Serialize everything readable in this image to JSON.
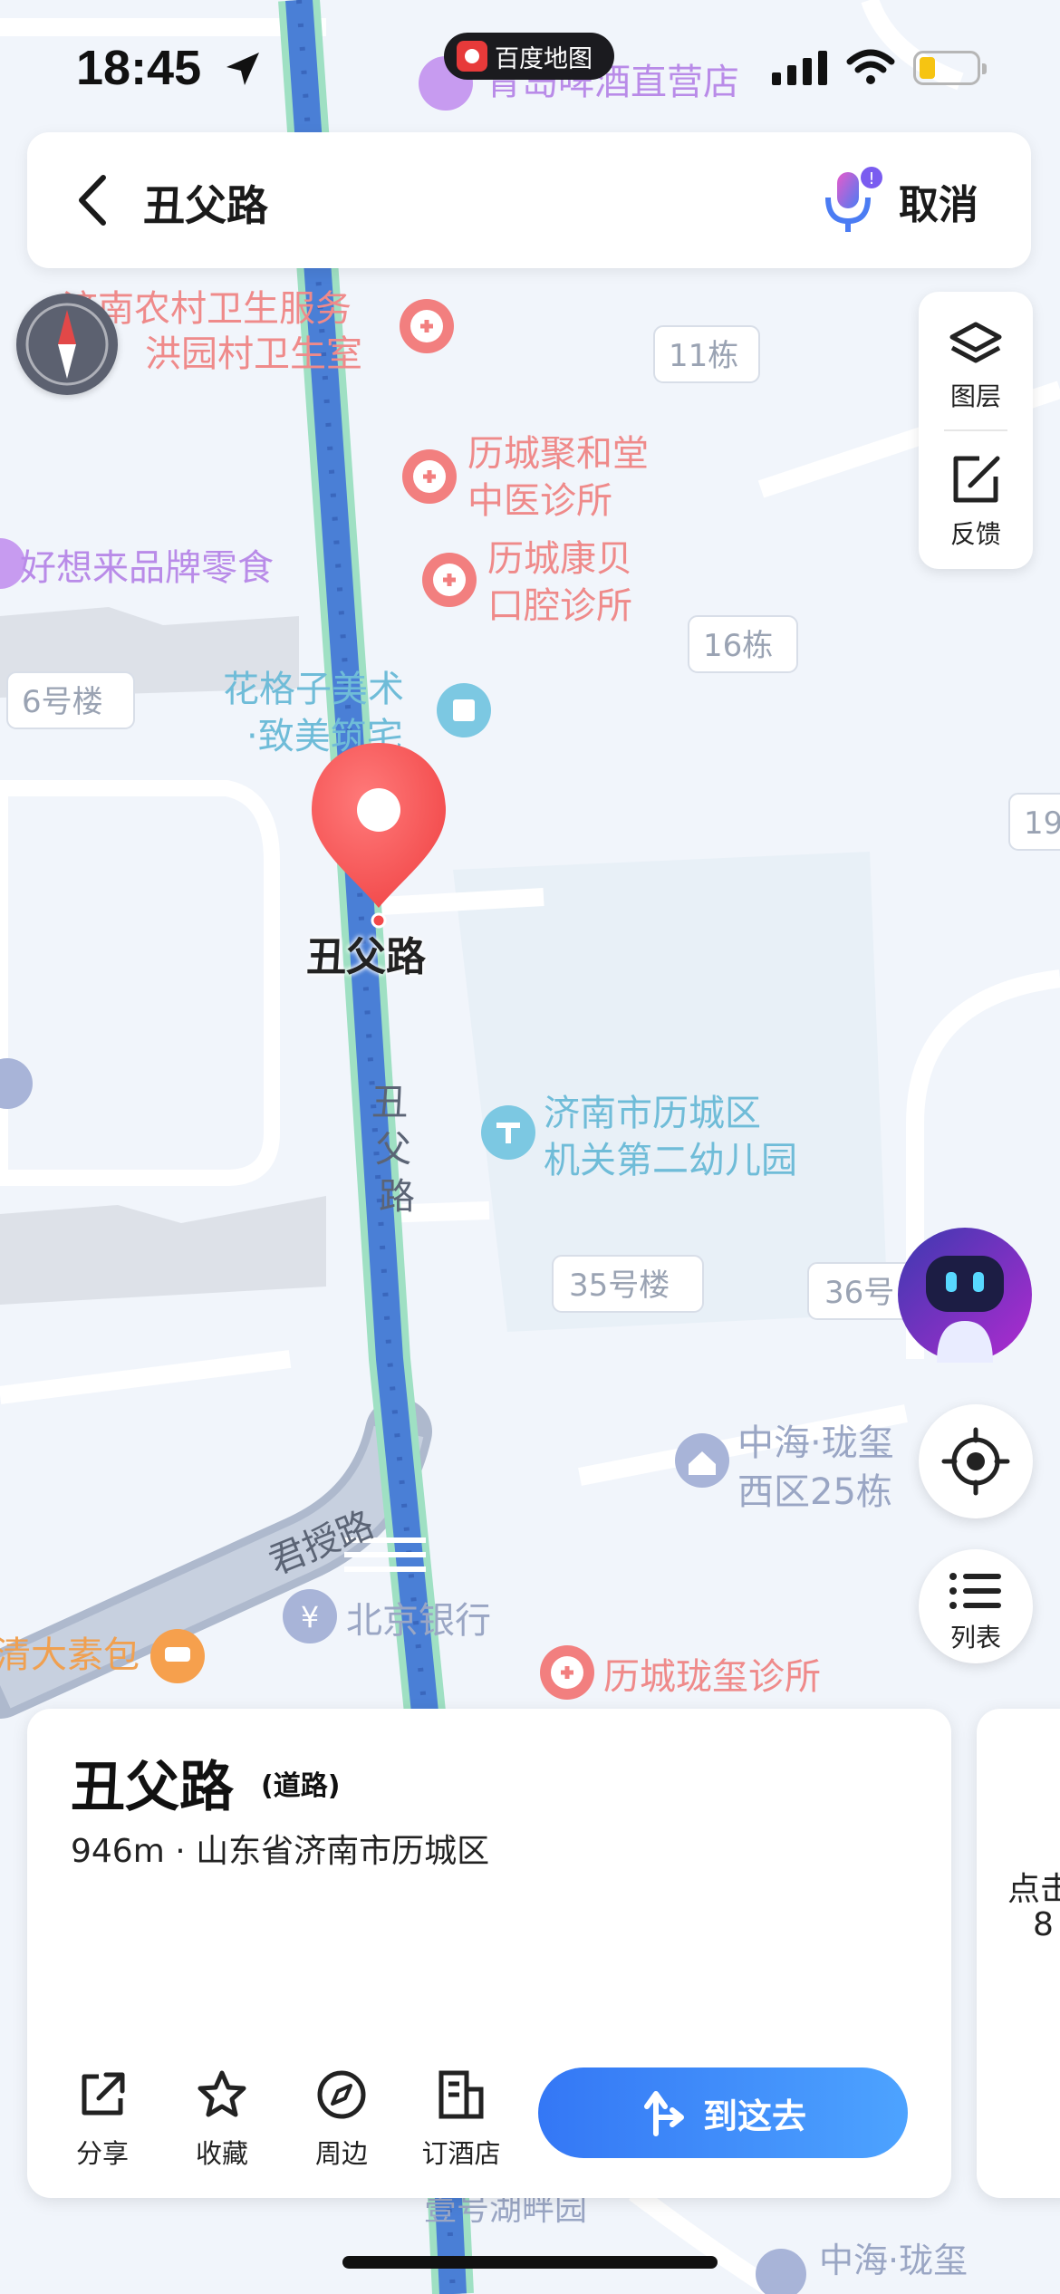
{
  "status_bar": {
    "time": "18:45",
    "app_name": "百度地图"
  },
  "search": {
    "query": "丑父路",
    "cancel_label": "取消"
  },
  "side_panel": {
    "layers_label": "图层",
    "feedback_label": "反馈"
  },
  "list_button": {
    "label": "列表"
  },
  "map": {
    "pin_label": "丑父路",
    "road_label_vertical": [
      "丑",
      "父",
      "路"
    ],
    "road_label_junjie": "君授路",
    "pois": [
      "青岛啤酒直营店",
      "济南农村卫生服务",
      "洪园村卫生室",
      "历城聚和堂",
      "中医诊所",
      "历城康贝",
      "口腔诊所",
      "好想来品牌零食",
      "花格子美术",
      "·致美筑宅",
      "济南市历城区",
      "机关第二幼儿园",
      "中海·珑玺",
      "西区25栋",
      "北京银行",
      "历城珑玺诊所",
      "清大素包",
      "中海·珑玺",
      "壹号湖畔园"
    ],
    "building_tags": [
      "11栋",
      "16栋",
      "6号楼",
      "19",
      "35号楼",
      "36号"
    ]
  },
  "place_card": {
    "name": "丑父路",
    "type": "(道路)",
    "info": "946m · 山东省济南市历城区",
    "actions": [
      "分享",
      "收藏",
      "周边",
      "订酒店"
    ],
    "go_label": "到这去"
  },
  "next_card": {
    "line1": "点击",
    "line2": "8"
  }
}
